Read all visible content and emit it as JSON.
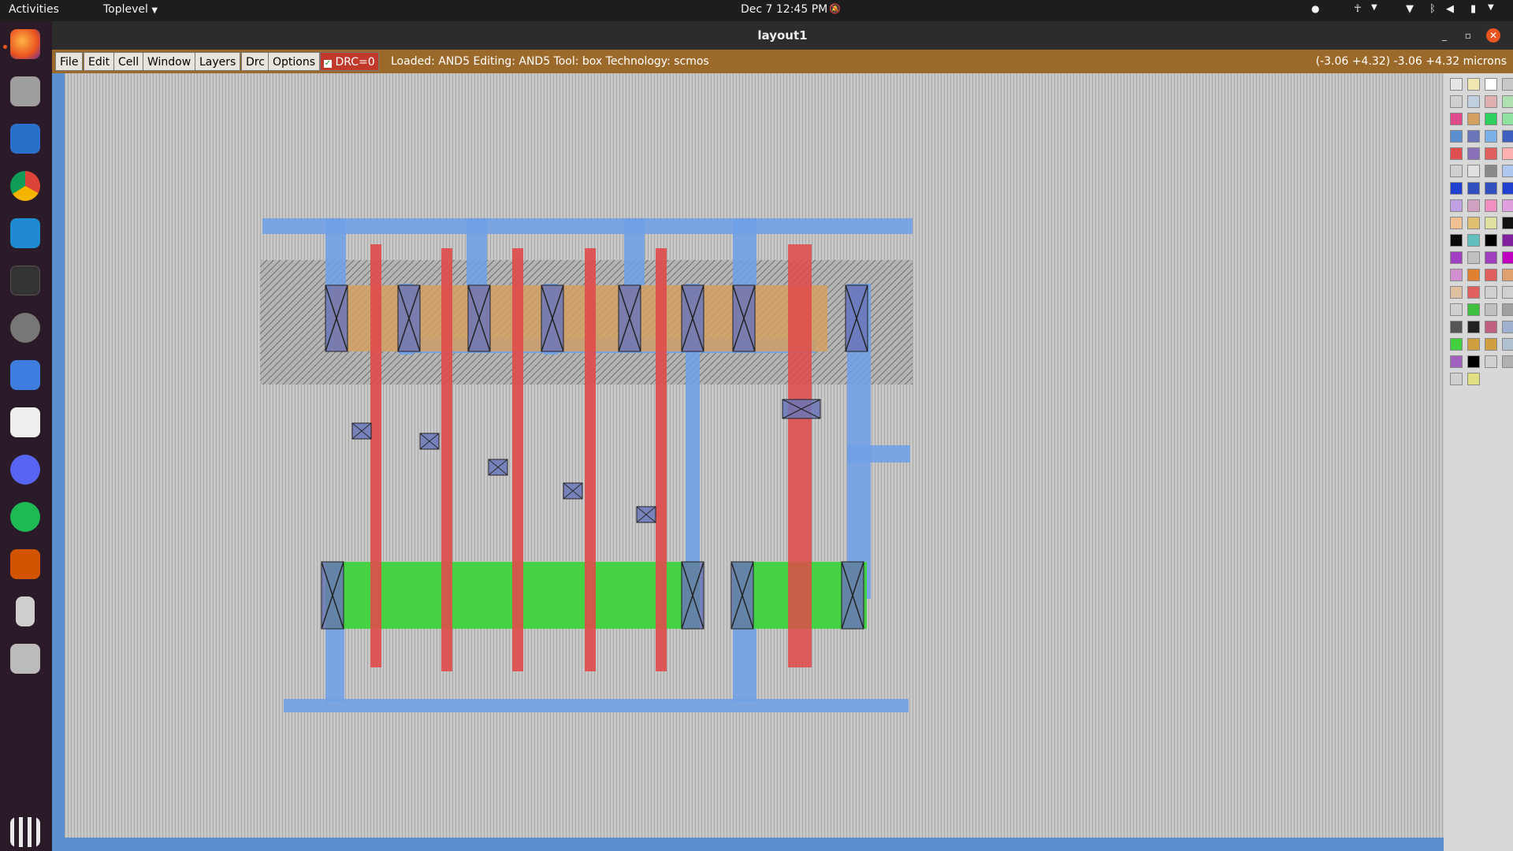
{
  "topbar": {
    "activities": "Activities",
    "app_menu": "Toplevel",
    "clock": "Dec 7  12:45 PM"
  },
  "window": {
    "title": "layout1"
  },
  "menu": {
    "items": [
      "File",
      "Edit",
      "Cell",
      "Window",
      "Layers",
      "Drc",
      "Options"
    ],
    "drc_label": "DRC=0",
    "status": "Loaded: AND5 Editing: AND5 Tool: box  Technology: scmos",
    "coords": "(-3.06 +4.32) -3.06 +4.32 microns"
  },
  "colors": {
    "metal1": "#6fa0e8",
    "poly": "#e04a4a",
    "pdiff": "#d4a060",
    "ndiff": "#3ed43e",
    "contact": "#6a76b8",
    "menubar": "#9b6a2a",
    "drc": "#c0392b"
  },
  "dock": {
    "icons": [
      "firefox-icon",
      "files-icon",
      "writer-icon",
      "chrome-icon",
      "vscode-icon",
      "terminal-icon",
      "settings-icon",
      "text-editor-icon",
      "document-viewer-icon",
      "discord-icon",
      "spotify-icon",
      "presentation-icon",
      "usb-drive-icon",
      "magnifier-icon",
      "app-grid-icon"
    ]
  },
  "layout_cell": {
    "name": "AND5",
    "gate_count": 6
  }
}
